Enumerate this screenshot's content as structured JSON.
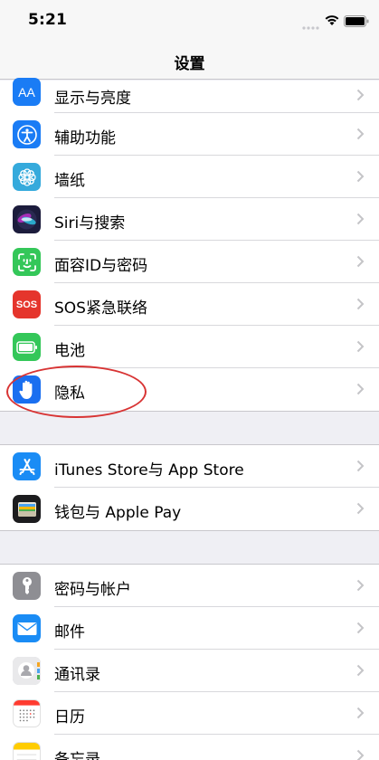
{
  "status": {
    "time": "5:21"
  },
  "nav": {
    "title": "设置"
  },
  "groups": [
    {
      "items": [
        {
          "label": "显示与亮度",
          "icon": "display-brightness-icon",
          "icon_text": "AA",
          "color": "#1a7cf5"
        },
        {
          "label": "辅助功能",
          "icon": "accessibility-icon",
          "color": "#1a7cf5"
        },
        {
          "label": "墙纸",
          "icon": "wallpaper-icon",
          "color": "#35aadc"
        },
        {
          "label": "Siri与搜索",
          "icon": "siri-icon",
          "color": "#1c1c3c"
        },
        {
          "label": "面容ID与密码",
          "icon": "face-id-icon",
          "color": "#34c759"
        },
        {
          "label": "SOS紧急联络",
          "icon": "sos-icon",
          "icon_text": "SOS",
          "color": "#e5352c"
        },
        {
          "label": "电池",
          "icon": "battery-icon",
          "color": "#34c759"
        },
        {
          "label": "隐私",
          "icon": "privacy-hand-icon",
          "color": "#1a6ff0"
        }
      ]
    },
    {
      "items": [
        {
          "label": "iTunes Store与 App Store",
          "icon": "app-store-icon",
          "color": "#1a8cf5"
        },
        {
          "label": "钱包与 Apple Pay",
          "icon": "wallet-icon",
          "color": "#1c1c1e"
        }
      ]
    },
    {
      "items": [
        {
          "label": "密码与帐户",
          "icon": "key-icon",
          "color": "#8e8e93"
        },
        {
          "label": "邮件",
          "icon": "mail-icon",
          "color": "#1a8cf5"
        },
        {
          "label": "通讯录",
          "icon": "contacts-icon",
          "color": "#d6d6d8"
        },
        {
          "label": "日历",
          "icon": "calendar-icon",
          "color": "#ffffff"
        },
        {
          "label": "备忘录",
          "icon": "notes-icon",
          "color": "#ffcc00"
        }
      ]
    }
  ],
  "annotation": {
    "color": "#d83434"
  }
}
